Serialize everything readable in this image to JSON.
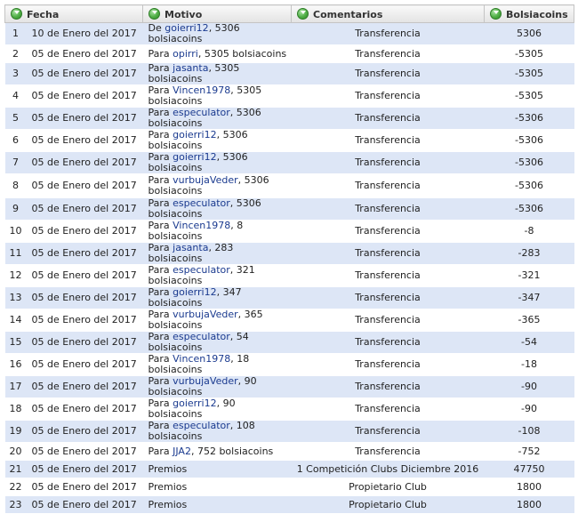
{
  "headers": {
    "fecha": "Fecha",
    "motivo": "Motivo",
    "comentarios": "Comentarios",
    "balance": "Bolsiacoins",
    "icon": "sort-icon"
  },
  "rows": [
    {
      "n": "1",
      "fecha": "10 de Enero del 2017",
      "pre": "De ",
      "user": "goierri12",
      "post": ", 5306 bolsiacoins",
      "com": "Transferencia",
      "bal": "5306"
    },
    {
      "n": "2",
      "fecha": "05 de Enero del 2017",
      "pre": "Para ",
      "user": "opirri",
      "post": ", 5305 bolsiacoins",
      "com": "Transferencia",
      "bal": "-5305"
    },
    {
      "n": "3",
      "fecha": "05 de Enero del 2017",
      "pre": "Para ",
      "user": "jasanta",
      "post": ", 5305 bolsiacoins",
      "com": "Transferencia",
      "bal": "-5305"
    },
    {
      "n": "4",
      "fecha": "05 de Enero del 2017",
      "pre": "Para ",
      "user": "Vincen1978",
      "post": ", 5305 bolsiacoins",
      "com": "Transferencia",
      "bal": "-5305"
    },
    {
      "n": "5",
      "fecha": "05 de Enero del 2017",
      "pre": "Para ",
      "user": "especulator",
      "post": ", 5306 bolsiacoins",
      "com": "Transferencia",
      "bal": "-5306"
    },
    {
      "n": "6",
      "fecha": "05 de Enero del 2017",
      "pre": "Para ",
      "user": "goierri12",
      "post": ", 5306 bolsiacoins",
      "com": "Transferencia",
      "bal": "-5306"
    },
    {
      "n": "7",
      "fecha": "05 de Enero del 2017",
      "pre": "Para ",
      "user": "goierri12",
      "post": ", 5306 bolsiacoins",
      "com": "Transferencia",
      "bal": "-5306"
    },
    {
      "n": "8",
      "fecha": "05 de Enero del 2017",
      "pre": "Para ",
      "user": "vurbujaVeder",
      "post": ", 5306 bolsiacoins",
      "com": "Transferencia",
      "bal": "-5306",
      "tall": true
    },
    {
      "n": "9",
      "fecha": "05 de Enero del 2017",
      "pre": "Para ",
      "user": "especulator",
      "post": ", 5306 bolsiacoins",
      "com": "Transferencia",
      "bal": "-5306"
    },
    {
      "n": "10",
      "fecha": "05 de Enero del 2017",
      "pre": "Para ",
      "user": "Vincen1978",
      "post": ", 8 bolsiacoins",
      "com": "Transferencia",
      "bal": "-8"
    },
    {
      "n": "11",
      "fecha": "05 de Enero del 2017",
      "pre": "Para ",
      "user": "jasanta",
      "post": ", 283 bolsiacoins",
      "com": "Transferencia",
      "bal": "-283"
    },
    {
      "n": "12",
      "fecha": "05 de Enero del 2017",
      "pre": "Para ",
      "user": "especulator",
      "post": ", 321 bolsiacoins",
      "com": "Transferencia",
      "bal": "-321"
    },
    {
      "n": "13",
      "fecha": "05 de Enero del 2017",
      "pre": "Para ",
      "user": "goierri12",
      "post": ", 347 bolsiacoins",
      "com": "Transferencia",
      "bal": "-347"
    },
    {
      "n": "14",
      "fecha": "05 de Enero del 2017",
      "pre": "Para ",
      "user": "vurbujaVeder",
      "post": ", 365 bolsiacoins",
      "com": "Transferencia",
      "bal": "-365"
    },
    {
      "n": "15",
      "fecha": "05 de Enero del 2017",
      "pre": "Para ",
      "user": "especulator",
      "post": ", 54 bolsiacoins",
      "com": "Transferencia",
      "bal": "-54"
    },
    {
      "n": "16",
      "fecha": "05 de Enero del 2017",
      "pre": "Para ",
      "user": "Vincen1978",
      "post": ", 18 bolsiacoins",
      "com": "Transferencia",
      "bal": "-18"
    },
    {
      "n": "17",
      "fecha": "05 de Enero del 2017",
      "pre": "Para ",
      "user": "vurbujaVeder",
      "post": ", 90 bolsiacoins",
      "com": "Transferencia",
      "bal": "-90"
    },
    {
      "n": "18",
      "fecha": "05 de Enero del 2017",
      "pre": "Para ",
      "user": "goierri12",
      "post": ", 90 bolsiacoins",
      "com": "Transferencia",
      "bal": "-90"
    },
    {
      "n": "19",
      "fecha": "05 de Enero del 2017",
      "pre": "Para ",
      "user": "especulator",
      "post": ", 108 bolsiacoins",
      "com": "Transferencia",
      "bal": "-108"
    },
    {
      "n": "20",
      "fecha": "05 de Enero del 2017",
      "pre": "Para ",
      "user": "JJA2",
      "post": ", 752 bolsiacoins",
      "com": "Transferencia",
      "bal": "-752"
    },
    {
      "n": "21",
      "fecha": "05 de Enero del 2017",
      "pre": "Premios",
      "user": "",
      "post": "",
      "com": "1 Competición Clubs Diciembre 2016",
      "bal": "47750"
    },
    {
      "n": "22",
      "fecha": "05 de Enero del 2017",
      "pre": "Premios",
      "user": "",
      "post": "",
      "com": "Propietario Club",
      "bal": "1800"
    },
    {
      "n": "23",
      "fecha": "05 de Enero del 2017",
      "pre": "Premios",
      "user": "",
      "post": "",
      "com": "Propietario Club",
      "bal": "1800"
    }
  ]
}
